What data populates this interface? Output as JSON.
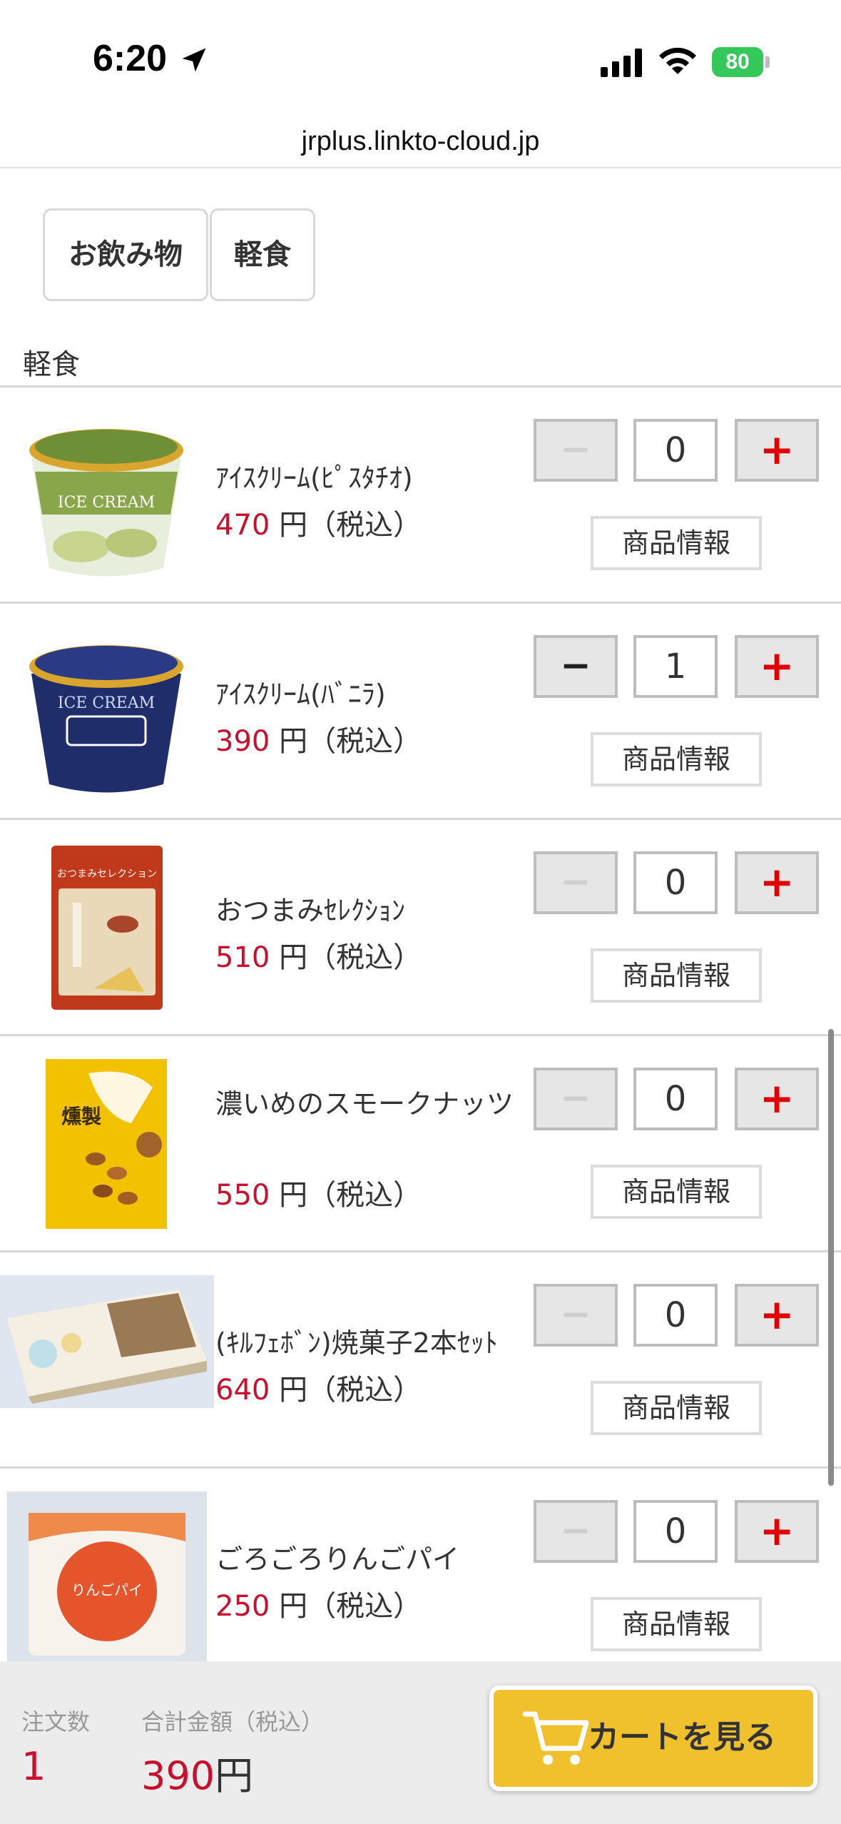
{
  "status_bar": {
    "time": "6:20",
    "battery": "80"
  },
  "url": "jrplus.linkto-cloud.jp",
  "tabs": [
    {
      "label": "お飲み物"
    },
    {
      "label": "軽食"
    }
  ],
  "section_title": "軽食",
  "products": [
    {
      "name": "ｱｲｽｸﾘｰﾑ(ﾋﾟｽﾀﾁｵ)",
      "price": "470",
      "price_suffix": "円（税込）",
      "qty": "0",
      "minus": "−",
      "plus": "+",
      "info": "商品情報",
      "image_label": "ICE CREAM"
    },
    {
      "name": "ｱｲｽｸﾘｰﾑ(ﾊﾞﾆﾗ)",
      "price": "390",
      "price_suffix": "円（税込）",
      "qty": "1",
      "minus": "−",
      "plus": "+",
      "info": "商品情報",
      "image_label": "ICE CREAM"
    },
    {
      "name": "おつまみｾﾚｸｼｮﾝ",
      "price": "510",
      "price_suffix": "円（税込）",
      "qty": "0",
      "minus": "−",
      "plus": "+",
      "info": "商品情報",
      "image_label": "おつまみセレクション"
    },
    {
      "name": "濃いめのスモークナッツ",
      "price": "550",
      "price_suffix": "円（税込）",
      "qty": "0",
      "minus": "−",
      "plus": "+",
      "info": "商品情報",
      "image_label": "燻製"
    },
    {
      "name": "(ｷﾙﾌｪﾎﾞﾝ)焼菓子2本ｾｯﾄ",
      "price": "640",
      "price_suffix": "円（税込）",
      "qty": "0",
      "minus": "−",
      "plus": "+",
      "info": "商品情報",
      "image_label": ""
    },
    {
      "name": "ごろごろりんごパイ",
      "price": "250",
      "price_suffix": "円（税込）",
      "qty": "0",
      "minus": "−",
      "plus": "+",
      "info": "商品情報",
      "image_label": "りんごパイ"
    }
  ],
  "footer": {
    "order_count_label": "注文数",
    "total_label": "合計金額（税込）",
    "order_count": "1",
    "total": "390",
    "total_unit": "円",
    "cart_button": "カートを見る"
  },
  "colors": {
    "price_red": "#c8102e",
    "plus_red": "#e00000",
    "cart_yellow": "#f0c12d",
    "battery_green": "#34c759"
  }
}
